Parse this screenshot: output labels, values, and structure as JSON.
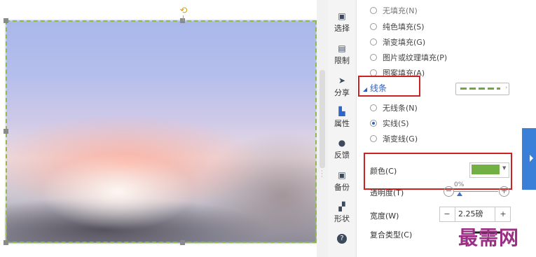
{
  "toolbar": {
    "items": [
      {
        "label": "选择",
        "icon": "select-icon"
      },
      {
        "label": "限制",
        "icon": "restrict-icon"
      },
      {
        "label": "分享",
        "icon": "share-icon"
      },
      {
        "label": "属性",
        "icon": "properties-icon"
      },
      {
        "label": "反馈",
        "icon": "feedback-icon"
      },
      {
        "label": "备份",
        "icon": "backup-icon"
      },
      {
        "label": "形状",
        "icon": "shape-icon"
      },
      {
        "label": "",
        "icon": "help-icon"
      }
    ]
  },
  "fill": {
    "options": [
      "无填充(N)",
      "纯色填充(S)",
      "渐变填充(G)",
      "图片或纹理填充(P)",
      "图案填充(A)"
    ]
  },
  "line": {
    "section_title": "线条",
    "options": [
      "无线条(N)",
      "实线(S)",
      "渐变线(G)"
    ],
    "selected": "实线(S)",
    "preview_color": "#6fa83e"
  },
  "properties": {
    "color_label": "颜色(C)",
    "color_value": "#73b043",
    "opacity_label": "透明度(T)",
    "opacity_value": "0%",
    "width_label": "宽度(W)",
    "width_value": "2.25磅",
    "compound_label": "复合类型(C)"
  },
  "watermark": "最需网",
  "colors": {
    "selection_border": "#8dbb4a",
    "highlight_box": "#cc2222",
    "accent": "#2b62c8"
  }
}
